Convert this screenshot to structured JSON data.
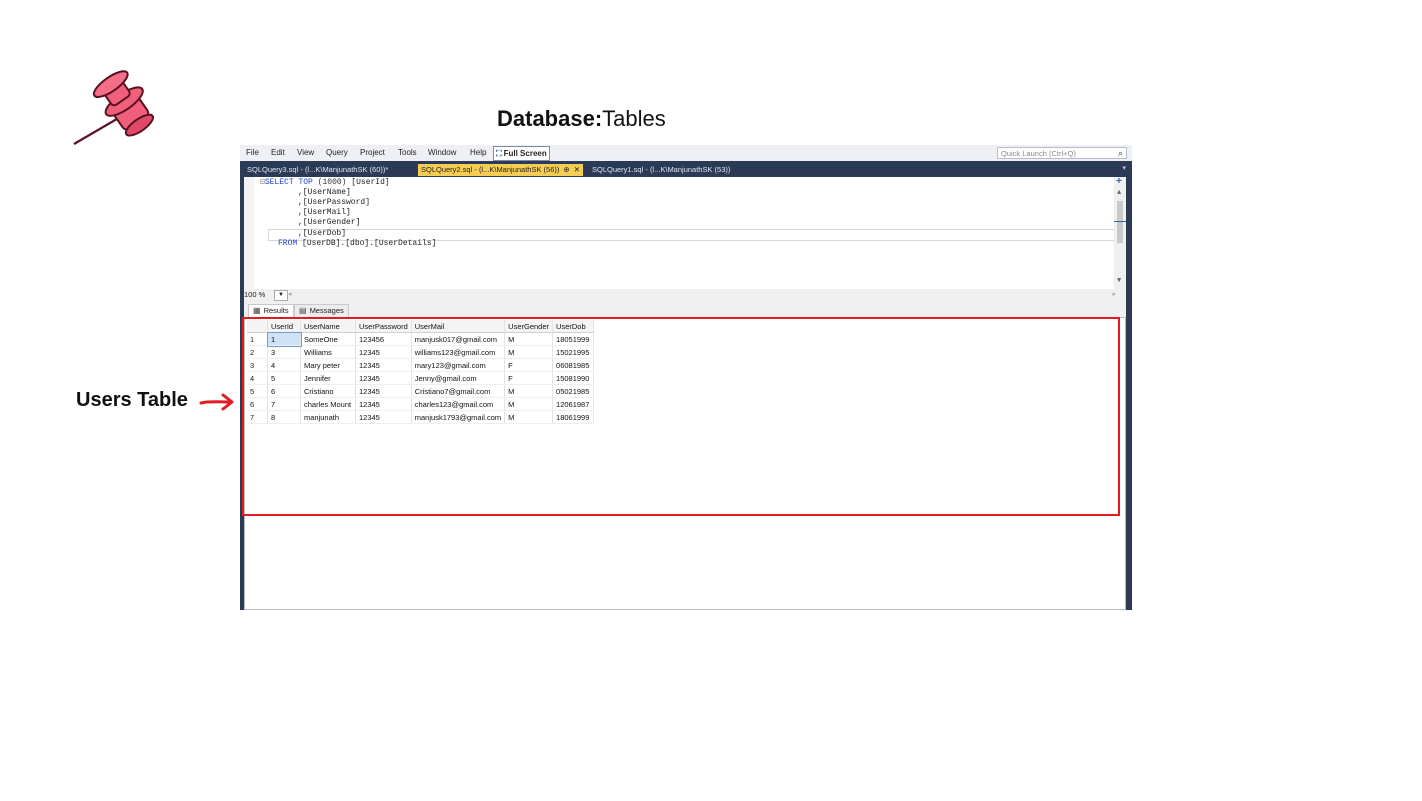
{
  "slide": {
    "title_bold": "Database:",
    "title_rest": "Tables",
    "users_label": "Users Table"
  },
  "menu": {
    "items": [
      "File",
      "Edit",
      "View",
      "Query",
      "Project",
      "Tools",
      "Window",
      "Help"
    ],
    "full_screen": "Full Screen",
    "quick_launch_placeholder": "Quick Launch (Ctrl+Q)"
  },
  "tabs": [
    {
      "label": "SQLQuery3.sql - (l...K\\ManjunathSK (60))*",
      "active": false
    },
    {
      "label": "SQLQuery2.sql - (l...K\\ManjunathSK (56))",
      "active": true
    },
    {
      "label": "SQLQuery1.sql - (l...K\\ManjunathSK (53))",
      "active": false
    }
  ],
  "editor": {
    "select_kw": "SELECT",
    "top_kw": "TOP",
    "top_num": "(1000)",
    "first_col": "[UserId]",
    "columns": [
      ",[UserName]",
      ",[UserPassword]",
      ",[UserMail]",
      ",[UserGender]",
      ",[UserDob]"
    ],
    "from_kw": "FROM",
    "from_rest": "[UserDB].[dbo].[UserDetails]"
  },
  "zoom": "100 %",
  "results_tabs": {
    "results": "Results",
    "messages": "Messages"
  },
  "grid": {
    "headers": [
      "UserId",
      "UserName",
      "UserPassword",
      "UserMail",
      "UserGender",
      "UserDob"
    ],
    "rows": [
      [
        "1",
        "1",
        "SomeOne",
        "123456",
        "manjusk017@gmail.com",
        "M",
        "18051999"
      ],
      [
        "2",
        "3",
        "Williams",
        "12345",
        "williams123@gmail.com",
        "M",
        "15021995"
      ],
      [
        "3",
        "4",
        "Mary peter",
        "12345",
        "mary123@gmail.com",
        "F",
        "06081985"
      ],
      [
        "4",
        "5",
        "Jennifer",
        "12345",
        "Jenny@gmail.com",
        "F",
        "15081990"
      ],
      [
        "5",
        "6",
        "Cristiano",
        "12345",
        "Cristiano7@gmail.com",
        "M",
        "05021985"
      ],
      [
        "6",
        "7",
        "charles Mount",
        "12345",
        "charles123@gmail.com",
        "M",
        "12061987"
      ],
      [
        "7",
        "8",
        "manjunath",
        "12345",
        "manjusk1793@gmail.com",
        "M",
        "18061999"
      ]
    ]
  },
  "colors": {
    "accent_tab": "#f5cc54",
    "annotation_red": "#e21b23",
    "pin_pink": "#f0607a"
  },
  "icons": [
    "pushpin-icon",
    "arrow-right-icon",
    "search-icon",
    "close-icon",
    "pin-tab-icon",
    "grid-icon",
    "messages-icon"
  ]
}
